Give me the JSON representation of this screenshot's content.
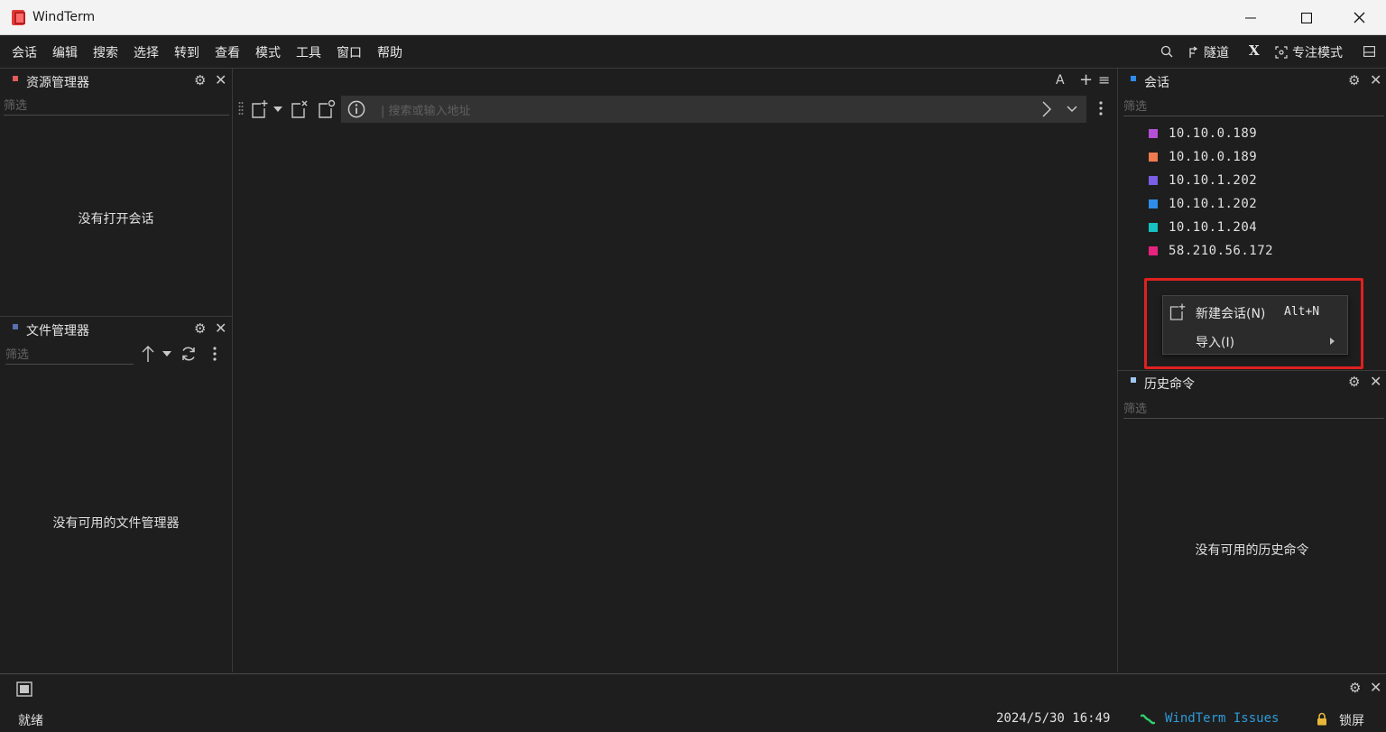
{
  "window": {
    "title": "WindTerm",
    "minimize_glyph": "—",
    "maximize_glyph": "☐",
    "close_glyph": "✕"
  },
  "menubar": {
    "items": [
      "会话",
      "编辑",
      "搜索",
      "选择",
      "转到",
      "查看",
      "模式",
      "工具",
      "窗口",
      "帮助"
    ],
    "tunnel_label": "隧道",
    "x_label": "X",
    "focus_mode_label": "专注模式"
  },
  "explorer": {
    "title": "资源管理器",
    "filter_placeholder": "筛选",
    "empty": "没有打开会话"
  },
  "file_manager": {
    "title": "文件管理器",
    "filter_placeholder": "筛选",
    "empty": "没有可用的文件管理器"
  },
  "center": {
    "font_button": "A",
    "add_button": "+",
    "menu_button": "≡",
    "address_placeholder": "| 搜索或输入地址"
  },
  "sessions": {
    "title": "会话",
    "filter_placeholder": "筛选",
    "items": [
      {
        "label": "10.10.0.189",
        "color": "#b44fd6"
      },
      {
        "label": "10.10.0.189",
        "color": "#f07b4e"
      },
      {
        "label": "10.10.1.202",
        "color": "#7a5ee6"
      },
      {
        "label": "10.10.1.202",
        "color": "#2f8ce8"
      },
      {
        "label": "10.10.1.204",
        "color": "#16c2c2"
      },
      {
        "label": "58.210.56.172",
        "color": "#e8237f"
      }
    ]
  },
  "context_menu": {
    "new_session": {
      "label": "新建会话(N)",
      "shortcut": "Alt+N"
    },
    "import": {
      "label": "导入(I)"
    }
  },
  "history": {
    "title": "历史命令",
    "filter_placeholder": "筛选",
    "empty": "没有可用的历史命令"
  },
  "statusbar": {
    "status": "就绪",
    "datetime": "2024/5/30 16:49",
    "issues_link": "WindTerm Issues",
    "lock_label": "锁屏"
  },
  "colors": {
    "explorer_mark": "#e35b5b",
    "filemgr_mark": "#5a6fb0",
    "sessions_mark": "#2f8ce8",
    "history_mark": "#9fc7ef",
    "link": "#2f9ad8",
    "highlight": "#e02020"
  }
}
